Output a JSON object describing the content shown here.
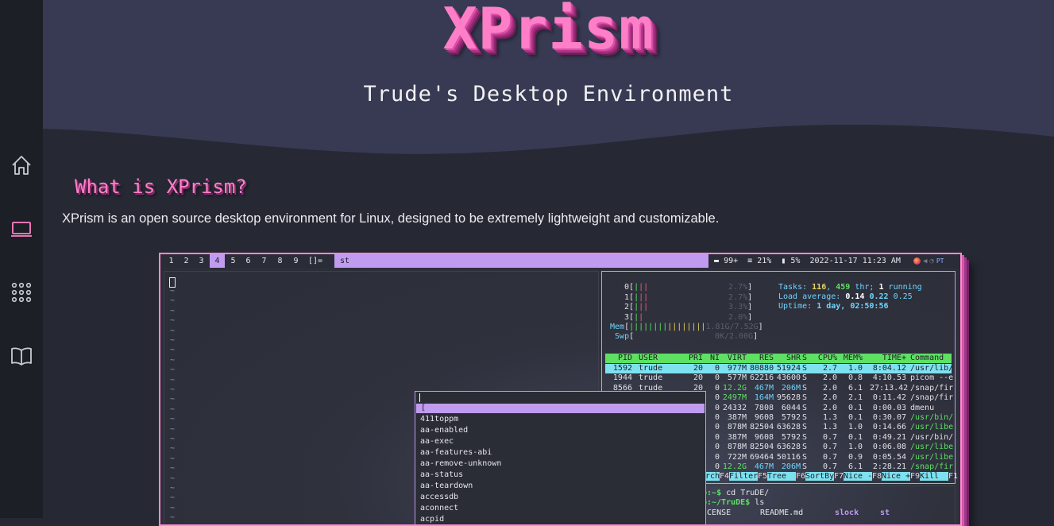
{
  "header": {
    "logo": "XPrism",
    "subtitle": "Trude's Desktop Environment"
  },
  "sidebar": {
    "items": [
      {
        "icon": "home-icon"
      },
      {
        "icon": "laptop-icon",
        "active": true
      },
      {
        "icon": "apps-grid-icon"
      },
      {
        "icon": "book-icon"
      }
    ],
    "active_color": "#ff80c9",
    "icon_color": "#c9cbd3"
  },
  "section": {
    "title": "What is XPrism?",
    "text": "XPrism is an open source desktop environment for Linux, designed to be extremely lightweight and customizable."
  },
  "screenshot": {
    "bar": {
      "workspaces": [
        "1",
        "2",
        "3",
        "4",
        "5",
        "6",
        "7",
        "8",
        "9"
      ],
      "active_workspace": "4",
      "layout": "[]=",
      "window_title": "st",
      "battery": "99+",
      "disk": "21%",
      "memory": "5%",
      "datetime": "2022-11-17 11:23 AM",
      "tray_label": "PT"
    },
    "htop": {
      "cpus": [
        {
          "id": "0",
          "bars": "||",
          "pct": "2.7%"
        },
        {
          "id": "1",
          "bars": "||",
          "pct": "2.7%"
        },
        {
          "id": "2",
          "bars": "||",
          "pct": "3.3%"
        },
        {
          "id": "3",
          "bars": "|",
          "pct": "2.0%"
        }
      ],
      "mem": {
        "label": "Mem",
        "bars": "||||||||||||||||",
        "value": "1.81G/7.52G"
      },
      "swp": {
        "label": "Swp",
        "value": "0K/2.00G"
      },
      "tasks": {
        "label": "Tasks:",
        "count": "116",
        "thr": "459",
        "thr_label": "thr;",
        "running": "1",
        "running_label": "running"
      },
      "load": {
        "label": "Load average:",
        "v1": "0.14",
        "v2": "0.22",
        "v3": "0.25"
      },
      "uptime": {
        "label": "Uptime:",
        "value": "1 day, 02:50:56"
      },
      "columns": [
        "PID",
        "USER",
        "PRI",
        "NI",
        "VIRT",
        "RES",
        "SHR",
        "S",
        "CPU%",
        "MEM%",
        "TIME+",
        "Command"
      ],
      "rows": [
        [
          "1592",
          "trude",
          "20",
          "0",
          "977M",
          "80880",
          "51924",
          "S",
          "2.7",
          "1.0",
          "8:04.12",
          "/usr/lib/"
        ],
        [
          "1944",
          "trude",
          "20",
          "0",
          "577M",
          "62216",
          "43600",
          "S",
          "2.0",
          "0.8",
          "4:10.53",
          "picom --e"
        ],
        [
          "8566",
          "trude",
          "20",
          "0",
          "12.2G",
          "467M",
          "206M",
          "S",
          "2.0",
          "6.1",
          "27:13.42",
          "/snap/fir"
        ],
        [
          "",
          "",
          "",
          "0",
          "2497M",
          "164M",
          "95628",
          "S",
          "2.0",
          "2.1",
          "0:11.42",
          "/snap/fir"
        ],
        [
          "",
          "",
          "",
          "0",
          "24332",
          "7808",
          "6044",
          "S",
          "2.0",
          "0.1",
          "0:00.03",
          "dmenu"
        ],
        [
          "",
          "",
          "",
          "0",
          "387M",
          "9608",
          "5792",
          "S",
          "1.3",
          "0.1",
          "0:30.07",
          "/usr/bin/"
        ],
        [
          "",
          "",
          "",
          "0",
          "878M",
          "82504",
          "63628",
          "S",
          "1.3",
          "1.0",
          "0:14.66",
          "/usr/libe"
        ],
        [
          "",
          "",
          "",
          "0",
          "387M",
          "9608",
          "5792",
          "S",
          "0.7",
          "0.1",
          "0:49.21",
          "/usr/bin/"
        ],
        [
          "",
          "",
          "",
          "0",
          "878M",
          "82504",
          "63628",
          "S",
          "0.7",
          "1.0",
          "0:06.08",
          "/usr/libe"
        ],
        [
          "",
          "",
          "",
          "0",
          "722M",
          "69464",
          "50116",
          "S",
          "0.7",
          "0.9",
          "0:05.54",
          "/usr/libe"
        ],
        [
          "",
          "",
          "",
          "0",
          "12.2G",
          "467M",
          "206M",
          "S",
          "0.7",
          "6.1",
          "2:28.21",
          "/snap/fir"
        ]
      ],
      "fkeys": [
        {
          "key": "",
          "label": "rch"
        },
        {
          "key": "F4",
          "label": "Filter"
        },
        {
          "key": "F5",
          "label": "Tree  "
        },
        {
          "key": "F6",
          "label": "SortBy"
        },
        {
          "key": "F7",
          "label": "Nice -"
        },
        {
          "key": "F8",
          "label": "Nice +"
        },
        {
          "key": "F9",
          "label": "Kill  "
        },
        {
          "key": "F1",
          "label": ""
        }
      ]
    },
    "terminal": {
      "line1_prompt": "op:~$",
      "line1_cmd": " cd TruDE/",
      "line2_prompt": "op:~/TruDE$",
      "line2_cmd": " ls",
      "files": [
        "LICENSE",
        "README.md",
        "slock",
        "st"
      ]
    },
    "dmenu": {
      "selected": "[",
      "items": [
        "411toppm",
        "aa-enabled",
        "aa-exec",
        "aa-features-abi",
        "aa-remove-unknown",
        "aa-status",
        "aa-teardown",
        "accessdb",
        "aconnect",
        "acpid"
      ]
    },
    "editor": {
      "tilde": "~"
    }
  }
}
